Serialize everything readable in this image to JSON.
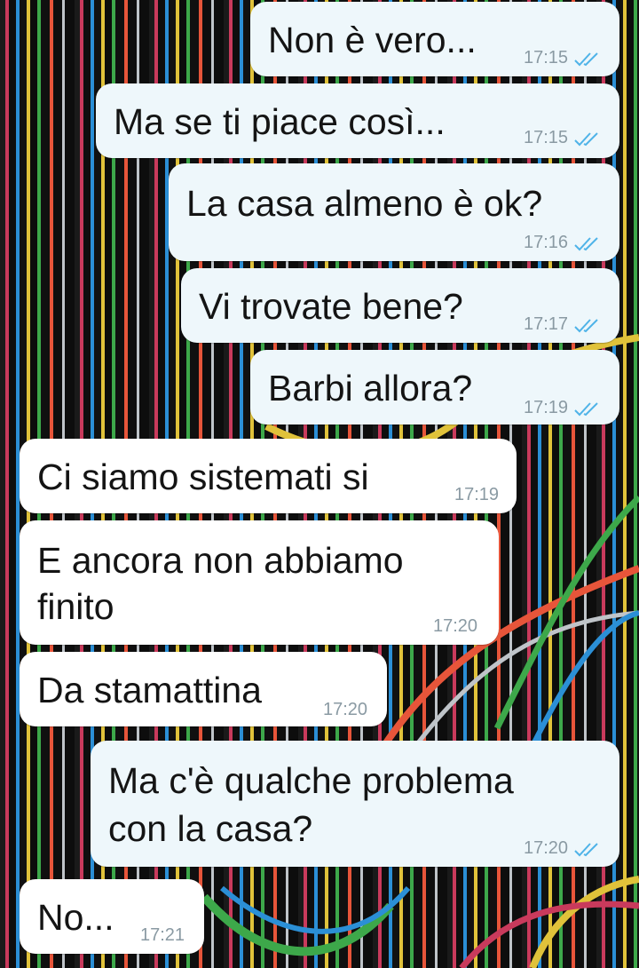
{
  "messages": [
    {
      "direction": "outgoing",
      "text": "Non è vero...",
      "time": "17:15",
      "status_icon": "double-check-read-icon"
    },
    {
      "direction": "outgoing",
      "text": "Ma se ti piace così...",
      "time": "17:15",
      "status_icon": "double-check-read-icon"
    },
    {
      "direction": "outgoing",
      "text": "La casa almeno è ok?",
      "time": "17:16",
      "status_icon": "double-check-read-icon"
    },
    {
      "direction": "outgoing",
      "text": "Vi trovate bene?",
      "time": "17:17",
      "status_icon": "double-check-read-icon"
    },
    {
      "direction": "outgoing",
      "text": "Barbi allora?",
      "time": "17:19",
      "status_icon": "double-check-read-icon"
    },
    {
      "direction": "incoming",
      "text": "Ci siamo sistemati si",
      "time": "17:19"
    },
    {
      "direction": "incoming",
      "lines": [
        "E ancora non abbiamo",
        "finito"
      ],
      "time": "17:20"
    },
    {
      "direction": "incoming",
      "text": "Da stamattina",
      "time": "17:20"
    },
    {
      "direction": "outgoing",
      "lines": [
        "Ma c'è qualche problema",
        "con la casa?"
      ],
      "time": "17:20",
      "status_icon": "double-check-read-icon"
    },
    {
      "direction": "incoming",
      "text": "No...",
      "time": "17:21"
    }
  ],
  "colors": {
    "outgoing_bubble": "#eef7fb",
    "incoming_bubble": "#ffffff",
    "read_ticks": "#4fb3e8",
    "time_text": "#8a9aa3"
  }
}
